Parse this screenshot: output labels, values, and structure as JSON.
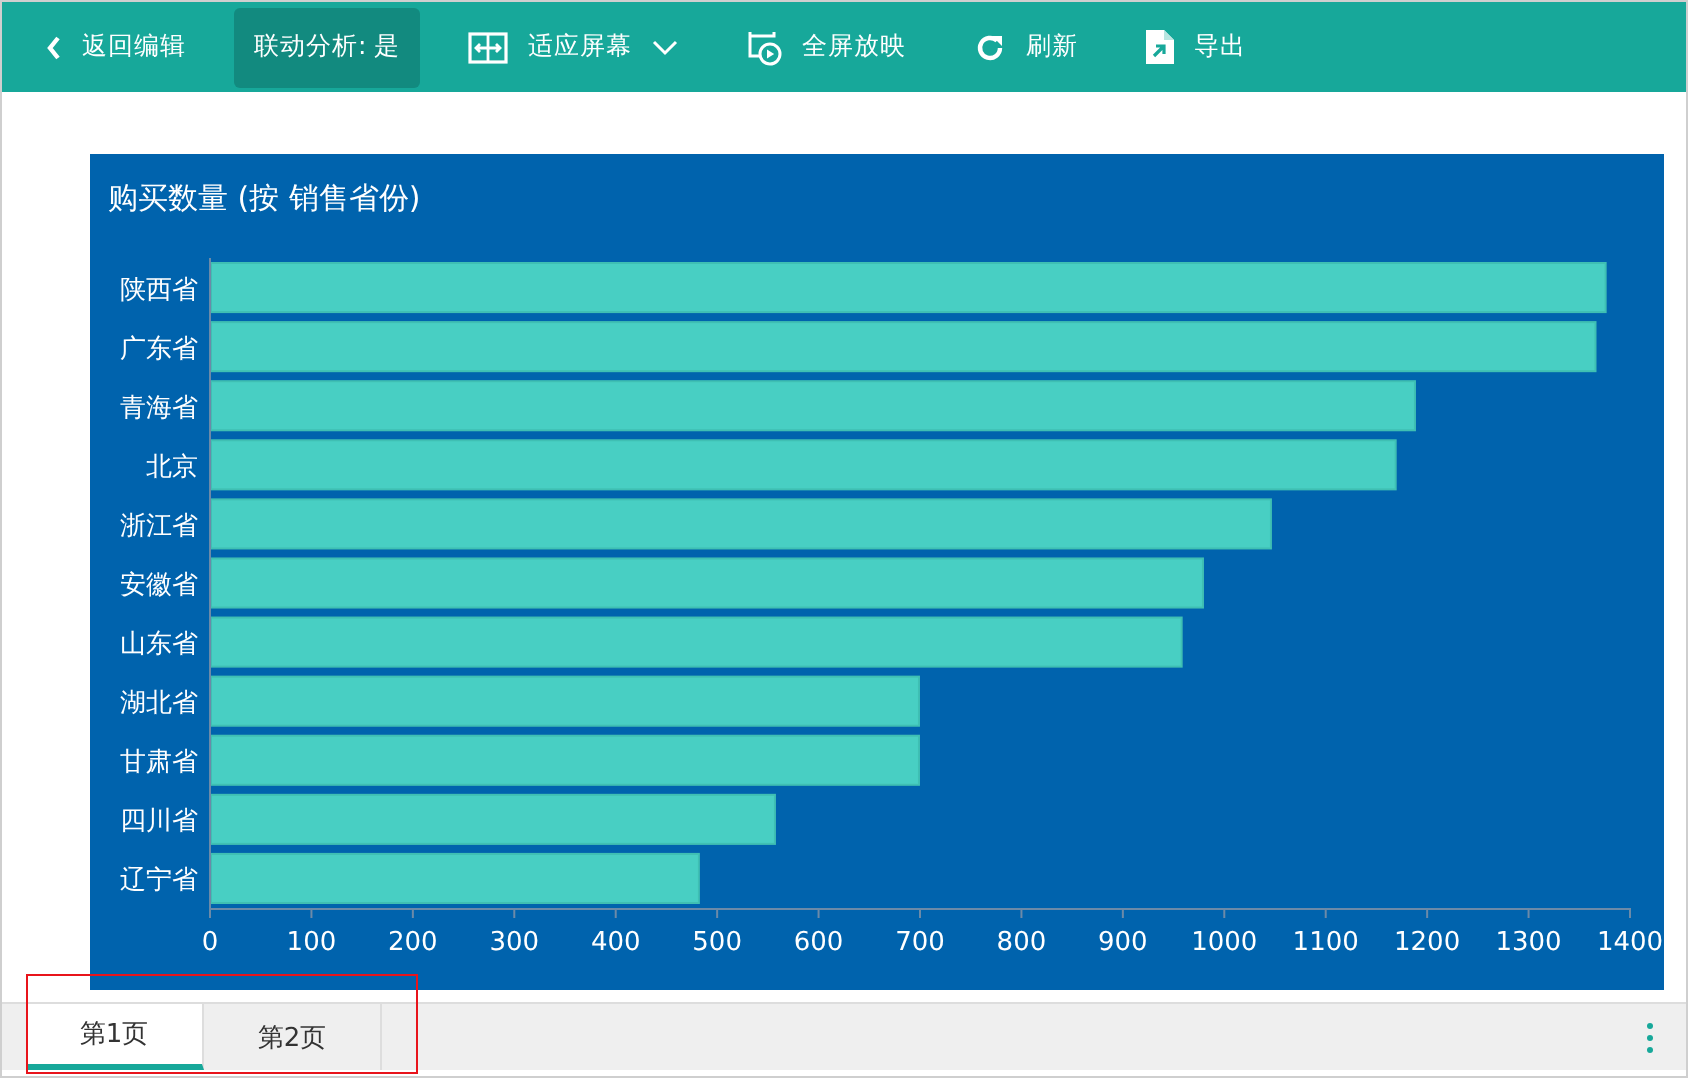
{
  "toolbar": [
    {
      "kind": "back",
      "label": "返回编辑"
    },
    {
      "kind": "toggle",
      "label": "联动分析: 是"
    },
    {
      "kind": "fit",
      "label": "适应屏幕"
    },
    {
      "kind": "fullscreen",
      "label": "全屏放映"
    },
    {
      "kind": "refresh",
      "label": "刷新"
    },
    {
      "kind": "export",
      "label": "导出"
    }
  ],
  "chart": {
    "chart_data": {
      "type": "bar",
      "orientation": "horizontal",
      "title": "购买数量 (按 销售省份)",
      "categories": [
        "陕西省",
        "广东省",
        "青海省",
        "北京",
        "浙江省",
        "安徽省",
        "山东省",
        "湖北省",
        "甘肃省",
        "四川省",
        "辽宁省"
      ],
      "series": [
        {
          "color": "#48cfc3",
          "values": [
            1375,
            1365,
            1187,
            1168,
            1045,
            978,
            957,
            698,
            698,
            556,
            481
          ]
        }
      ],
      "xlim": [
        0,
        1400
      ],
      "xticks": [
        0,
        100,
        200,
        300,
        400,
        500,
        600,
        700,
        800,
        900,
        1000,
        1100,
        1200,
        1300,
        1400
      ]
    }
  },
  "page_tabs": [
    {
      "label": "第1页",
      "selected": true
    },
    {
      "label": "第2页",
      "selected": false
    }
  ]
}
